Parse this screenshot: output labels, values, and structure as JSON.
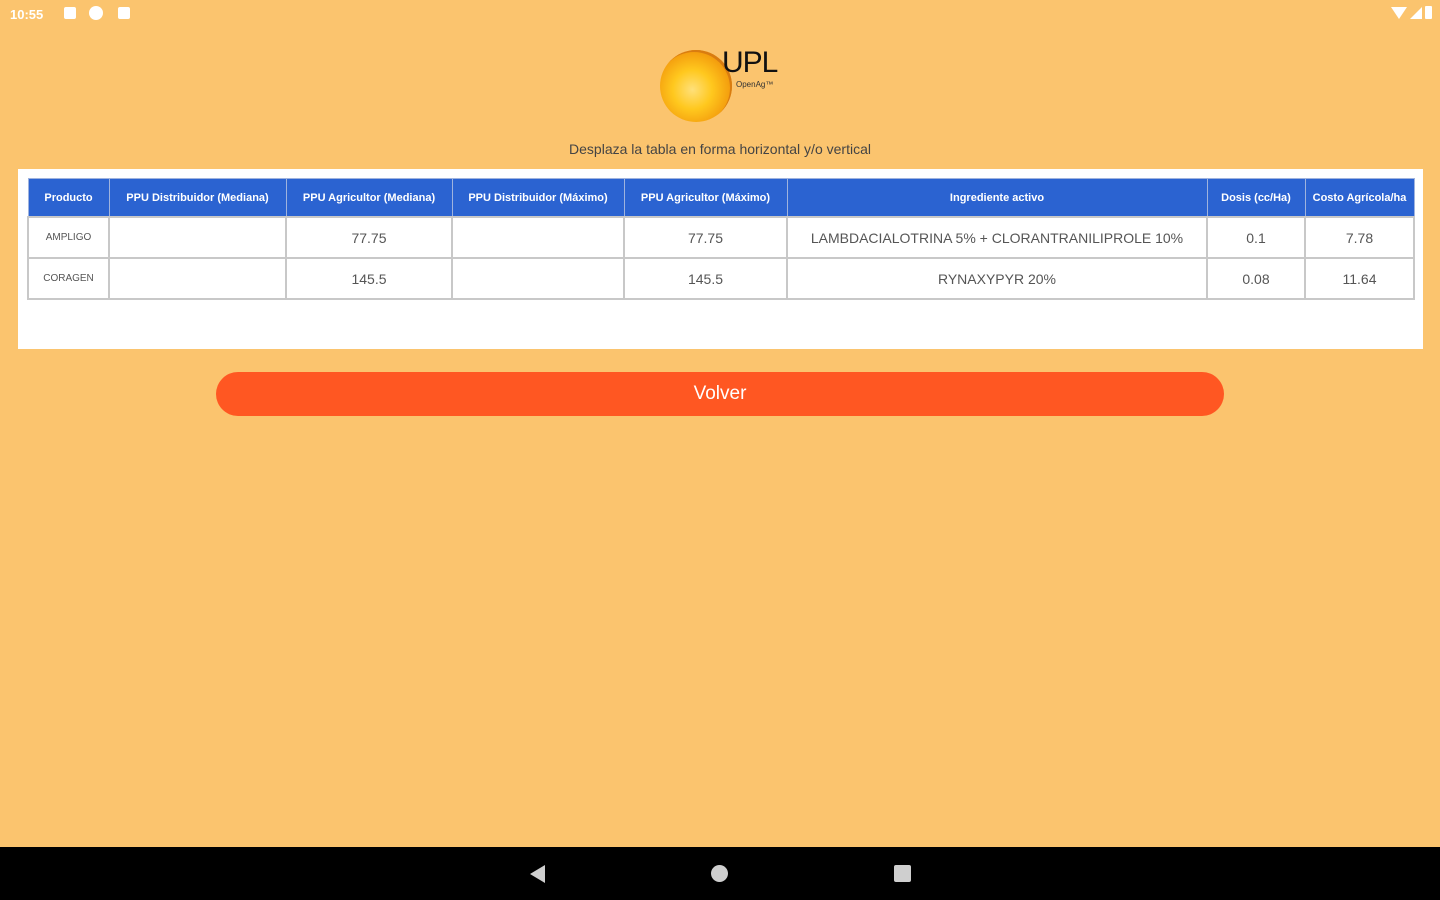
{
  "status_bar": {
    "time": "10:55",
    "left_icons": [
      "notification-square-icon",
      "pinwheel-icon",
      "sd-card-icon"
    ],
    "right_icons": [
      "wifi-icon",
      "signal-icon",
      "battery-icon"
    ]
  },
  "logo": {
    "text": "UPL",
    "tagline": "OpenAg™"
  },
  "hint": "Desplaza la tabla en forma horizontal y/o vertical",
  "table": {
    "headers": [
      "Producto",
      "PPU Distribuidor (Mediana)",
      "PPU Agricultor (Mediana)",
      "PPU Distribuidor (Máximo)",
      "PPU Agricultor (Máximo)",
      "Ingrediente activo",
      "Dosis (cc/Ha)",
      "Costo Agrícola/ha"
    ],
    "rows": [
      [
        "AMPLIGO",
        "",
        "77.75",
        "",
        "77.75",
        "LAMBDACIALOTRINA 5% + CLORANTRANILIPROLE 10%",
        "0.1",
        "7.78"
      ],
      [
        "CORAGEN",
        "",
        "145.5",
        "",
        "145.5",
        "RYNAXYPYR 20%",
        "0.08",
        "11.64"
      ]
    ]
  },
  "button": {
    "label": "Volver"
  },
  "nav_bar": {
    "icons": [
      "back-icon",
      "home-icon",
      "recents-icon"
    ]
  },
  "colors": {
    "background": "#fbc46e",
    "header": "#2b63d1",
    "button": "#ff5722"
  }
}
